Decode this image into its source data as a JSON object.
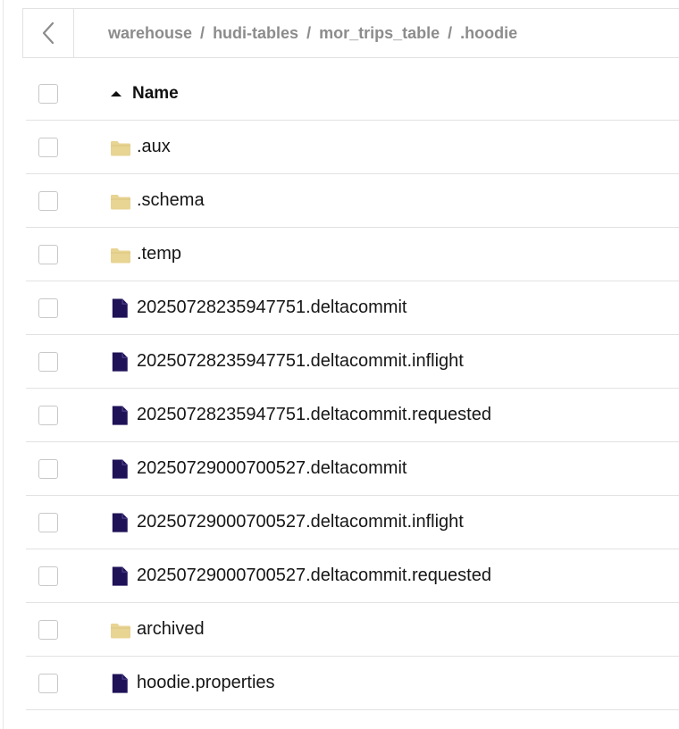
{
  "breadcrumb": {
    "segments": [
      "warehouse",
      "hudi-tables",
      "mor_trips_table",
      ".hoodie"
    ],
    "separator": "/"
  },
  "table": {
    "header": {
      "name_label": "Name",
      "sort": "ascending"
    },
    "rows": [
      {
        "name": ".aux",
        "type": "folder"
      },
      {
        "name": ".schema",
        "type": "folder"
      },
      {
        "name": ".temp",
        "type": "folder"
      },
      {
        "name": "20250728235947751.deltacommit",
        "type": "file"
      },
      {
        "name": "20250728235947751.deltacommit.inflight",
        "type": "file"
      },
      {
        "name": "20250728235947751.deltacommit.requested",
        "type": "file"
      },
      {
        "name": "20250729000700527.deltacommit",
        "type": "file"
      },
      {
        "name": "20250729000700527.deltacommit.inflight",
        "type": "file"
      },
      {
        "name": "20250729000700527.deltacommit.requested",
        "type": "file"
      },
      {
        "name": "archived",
        "type": "folder"
      },
      {
        "name": "hoodie.properties",
        "type": "file"
      }
    ]
  },
  "icons": {
    "back": "chevron-left-icon",
    "sort": "sort-ascending-icon",
    "folder": "folder-icon",
    "file": "file-icon"
  },
  "colors": {
    "folder": "#e8d493",
    "file": "#1f1257",
    "breadcrumb_text": "#8c8c8c",
    "border": "#e2e2e2"
  }
}
